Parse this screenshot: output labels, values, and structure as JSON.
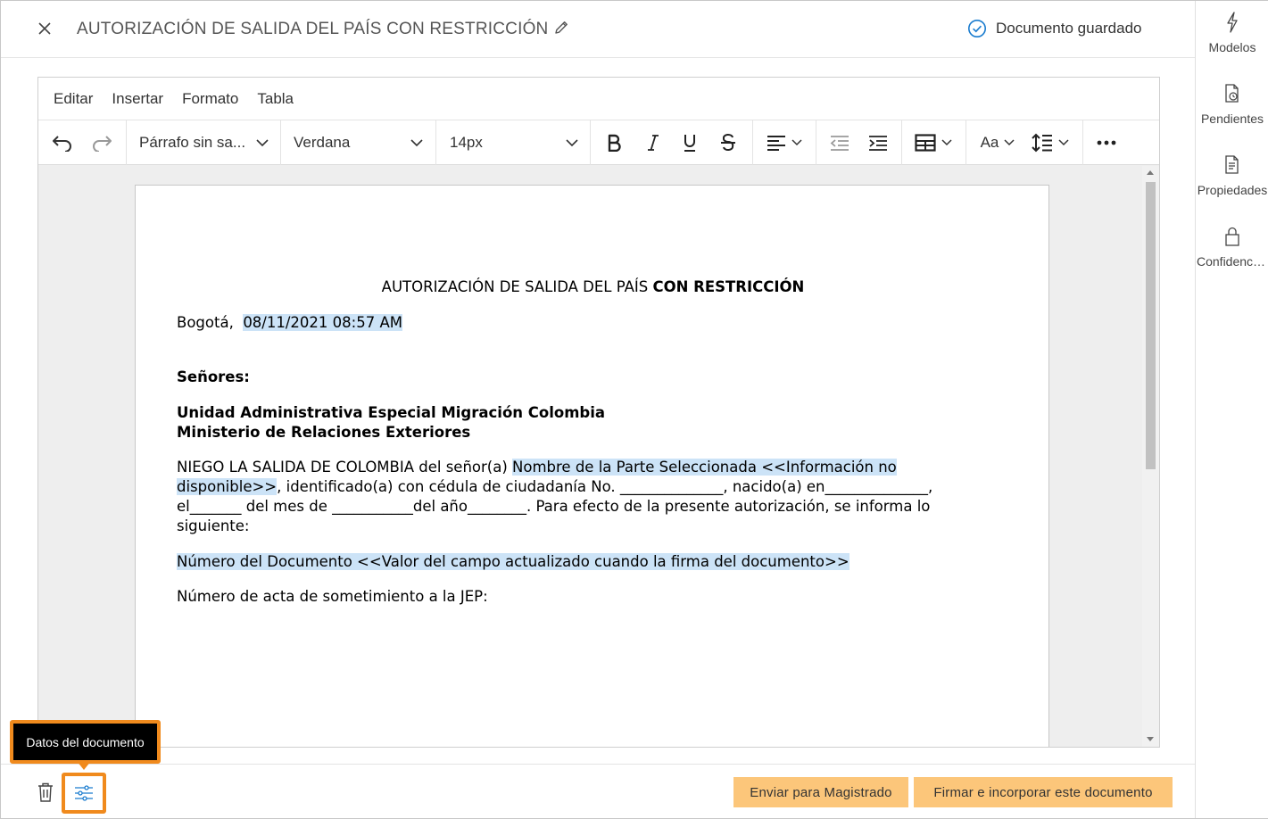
{
  "header": {
    "title": "AUTORIZACIÓN DE SALIDA DEL PAÍS CON RESTRICCIÓN",
    "status": "Documento guardado"
  },
  "right_panel": {
    "items": [
      {
        "label": "Modelos",
        "icon": "lightning-icon"
      },
      {
        "label": "Pendientes",
        "icon": "pending-doc-icon"
      },
      {
        "label": "Propiedades",
        "icon": "properties-doc-icon"
      },
      {
        "label": "Confidencialidad",
        "icon": "lock-icon"
      }
    ]
  },
  "editor": {
    "menu": [
      "Editar",
      "Insertar",
      "Formato",
      "Tabla"
    ],
    "toolbar": {
      "paragraph_style": "Párrafo sin sa...",
      "font_family": "Verdana",
      "font_size": "14px",
      "case_label": "Aa"
    }
  },
  "document": {
    "title_normal": "AUTORIZACIÓN DE SALIDA DEL PAÍS ",
    "title_bold": "CON RESTRICCIÓN",
    "city": "Bogotá,  ",
    "date": "08/11/2021 08:57 AM",
    "salutation": "Señores:",
    "recipient_1": "Unidad Administrativa Especial Migración Colombia",
    "recipient_2": "Ministerio de Relaciones Exteriores",
    "body_pre": "NIEGO LA SALIDA DE COLOMBIA del señor(a) ",
    "body_field": "Nombre de la Parte Seleccionada <<Información no disponible>>",
    "body_post": ", identificado(a) con cédula de ciudadanía No. ______________, nacido(a) en______________, el_______ del mes de ___________del año________. Para efecto de la presente autorización, se informa lo siguiente:",
    "doc_number_field": "Número del Documento <<Valor del campo actualizado cuando la firma del documento>>",
    "act_number": "Número de acta de sometimiento a la JEP:"
  },
  "footer": {
    "tooltip": "Datos del documento",
    "send_button": "Enviar para Magistrado",
    "sign_button": "Firmar e incorporar este documento"
  },
  "colors": {
    "accent": "#1a7ccf",
    "highlight": "#cce3f7",
    "button_bg": "#fcc67a",
    "callout": "#f08a1d"
  }
}
